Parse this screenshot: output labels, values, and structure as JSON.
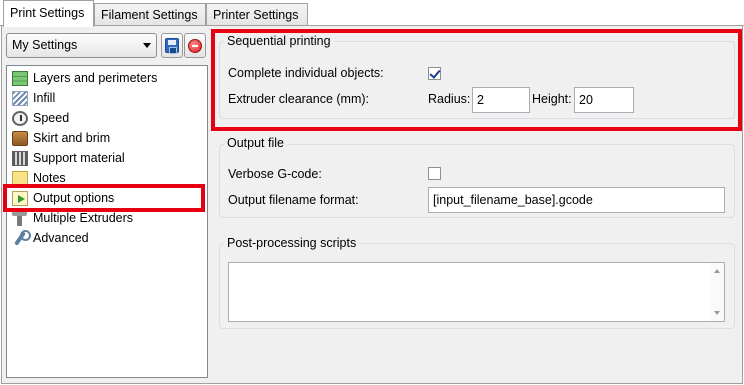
{
  "tabs": [
    {
      "label": "Print Settings",
      "active": true
    },
    {
      "label": "Filament Settings",
      "active": false
    },
    {
      "label": "Printer Settings",
      "active": false
    }
  ],
  "preset": {
    "selected": "My Settings"
  },
  "tree": {
    "items": [
      {
        "label": "Layers and perimeters",
        "icon": "layers-icon"
      },
      {
        "label": "Infill",
        "icon": "infill-icon"
      },
      {
        "label": "Speed",
        "icon": "speed-icon"
      },
      {
        "label": "Skirt and brim",
        "icon": "skirt-icon"
      },
      {
        "label": "Support material",
        "icon": "support-icon"
      },
      {
        "label": "Notes",
        "icon": "notes-icon"
      },
      {
        "label": "Output options",
        "icon": "output-icon",
        "selected": true
      },
      {
        "label": "Multiple Extruders",
        "icon": "extruder-icon"
      },
      {
        "label": "Advanced",
        "icon": "wrench-icon"
      }
    ]
  },
  "sequential": {
    "title": "Sequential printing",
    "complete_label": "Complete individual objects:",
    "complete_checked": true,
    "clearance_label": "Extruder clearance (mm):",
    "radius_label": "Radius:",
    "radius_value": "2",
    "height_label": "Height:",
    "height_value": "20"
  },
  "output_file": {
    "title": "Output file",
    "verbose_label": "Verbose G-code:",
    "verbose_checked": false,
    "format_label": "Output filename format:",
    "format_value": "[input_filename_base].gcode"
  },
  "post_processing": {
    "title": "Post-processing scripts",
    "value": ""
  },
  "colors": {
    "highlight": "#e60012",
    "panel_bg": "#f0f0f0"
  }
}
